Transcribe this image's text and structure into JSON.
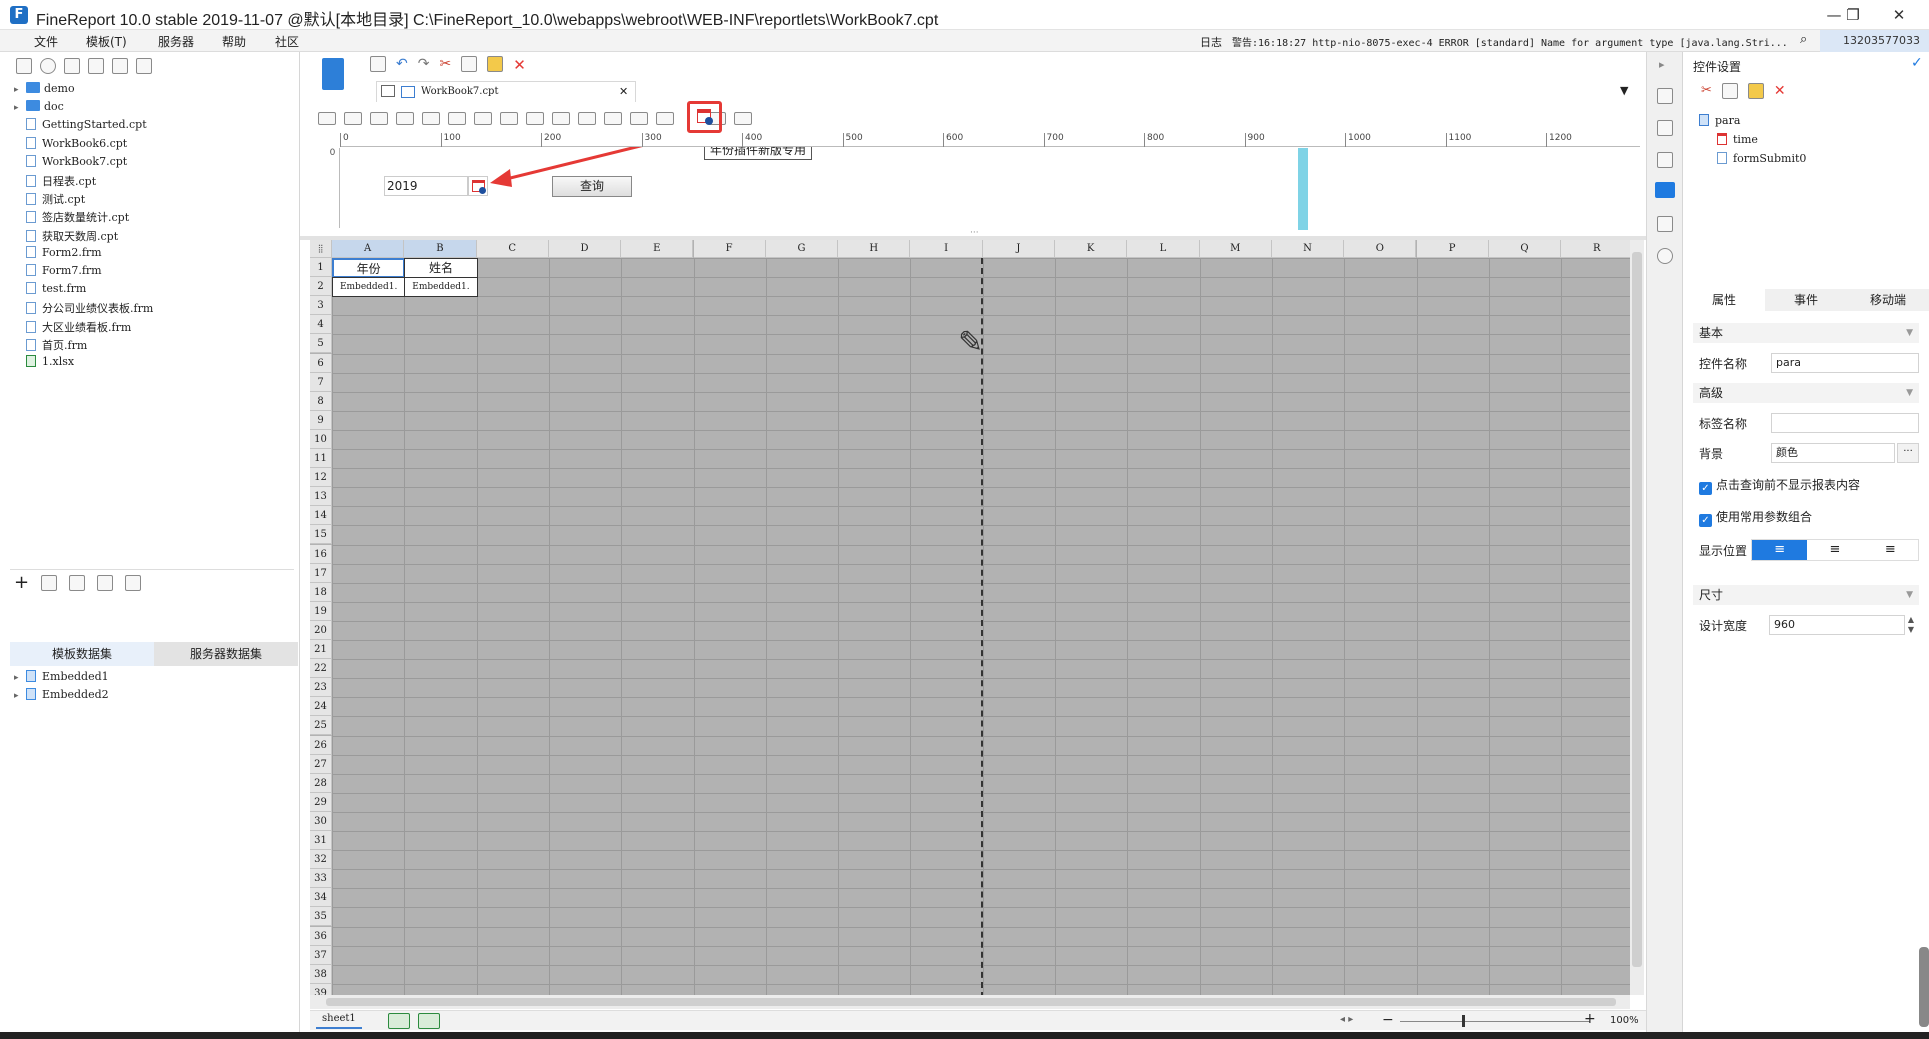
{
  "window": {
    "title": "FineReport 10.0 stable 2019-11-07 @默认[本地目录]    C:\\FineReport_10.0\\webapps\\webroot\\WEB-INF\\reportlets\\WorkBook7.cpt",
    "logo": "F",
    "minimize": "—",
    "restore": "❐",
    "close": "✕"
  },
  "menu": {
    "items": [
      "文件",
      "模板(T)",
      "服务器",
      "帮助",
      "社区"
    ]
  },
  "log": {
    "label": "日志",
    "message": "警告:16:18:27 http-nio-8075-exec-4 ERROR [standard] Name for argument type [java.lang.Stri...",
    "user_id": "13203577033"
  },
  "file_tree": [
    {
      "name": "demo",
      "type": "folder"
    },
    {
      "name": "doc",
      "type": "folder"
    },
    {
      "name": "GettingStarted.cpt",
      "type": "file"
    },
    {
      "name": "WorkBook6.cpt",
      "type": "file"
    },
    {
      "name": "WorkBook7.cpt",
      "type": "file"
    },
    {
      "name": "日程表.cpt",
      "type": "file"
    },
    {
      "name": "测试.cpt",
      "type": "file"
    },
    {
      "name": "签店数量统计.cpt",
      "type": "file"
    },
    {
      "name": "获取天数周.cpt",
      "type": "file"
    },
    {
      "name": "Form2.frm",
      "type": "file"
    },
    {
      "name": "Form7.frm",
      "type": "file"
    },
    {
      "name": "test.frm",
      "type": "file"
    },
    {
      "name": "分公司业绩仪表板.frm",
      "type": "file"
    },
    {
      "name": "大区业绩看板.frm",
      "type": "file"
    },
    {
      "name": "首页.frm",
      "type": "file"
    },
    {
      "name": "1.xlsx",
      "type": "xlsx"
    }
  ],
  "datasets": {
    "tabs": [
      "模板数据集",
      "服务器数据集"
    ],
    "items": [
      "Embedded1",
      "Embedded2"
    ]
  },
  "editor": {
    "tab_name": "WorkBook7.cpt",
    "tooltip": "年份插件新版专用",
    "ruler_ticks": [
      "0",
      "100",
      "200",
      "300",
      "400",
      "500",
      "600",
      "700",
      "800",
      "900",
      "1000",
      "1100",
      "1200"
    ],
    "param_year_value": "2019",
    "query_button": "查询"
  },
  "sheet": {
    "columns": [
      "A",
      "B",
      "C",
      "D",
      "E",
      "F",
      "G",
      "H",
      "I",
      "J",
      "K",
      "L",
      "M",
      "N",
      "O",
      "P",
      "Q",
      "R"
    ],
    "rows": [
      "1",
      "2",
      "3",
      "4",
      "5",
      "6",
      "7",
      "8",
      "9",
      "10",
      "11",
      "12",
      "13",
      "14",
      "15",
      "16",
      "17",
      "18",
      "19",
      "20",
      "21",
      "22",
      "23",
      "24",
      "25",
      "26",
      "27",
      "28",
      "29",
      "30",
      "31",
      "32",
      "33",
      "34",
      "35",
      "36",
      "37",
      "38",
      "39"
    ],
    "cells": {
      "A1": "年份",
      "B1": "姓名",
      "A2": "Embedded1.",
      "B2": "Embedded1."
    },
    "sheet_tab": "sheet1",
    "zoom": "100%"
  },
  "right_panel": {
    "title": "控件设置",
    "tree": [
      "para",
      "time",
      "formSubmit0"
    ],
    "tabs": [
      "属性",
      "事件",
      "移动端"
    ],
    "sections": {
      "basic": "基本",
      "advanced": "高级",
      "size": "尺寸"
    },
    "widget_name_label": "控件名称",
    "widget_name_value": "para",
    "tag_name_label": "标签名称",
    "tag_name_value": "",
    "background_label": "背景",
    "background_value": "颜色",
    "checkbox1": "点击查询前不显示报表内容",
    "checkbox2": "使用常用参数组合",
    "position_label": "显示位置",
    "design_width_label": "设计宽度",
    "design_width_value": "960"
  },
  "colors": {
    "accent": "#1f7ae0",
    "grid_bg": "#b2b2b2",
    "highlight_red": "#e53935",
    "ruler_marker": "#7fd3e6"
  }
}
